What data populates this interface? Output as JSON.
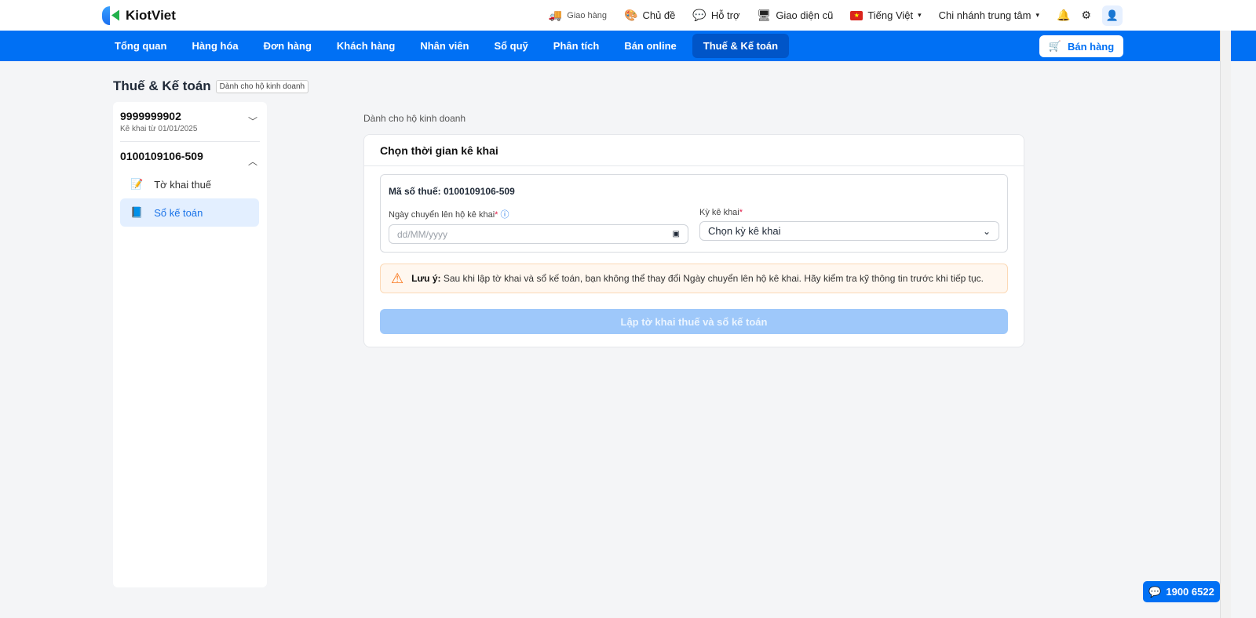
{
  "app": {
    "name": "KiotViet"
  },
  "topbar": {
    "delivery": "Giao hàng",
    "theme": "Chủ đề",
    "support": "Hỗ trợ",
    "old_ui": "Giao diện cũ",
    "language": "Tiếng Việt",
    "branch": "Chi nhánh trung tâm"
  },
  "nav": {
    "items": [
      "Tổng quan",
      "Hàng hóa",
      "Đơn hàng",
      "Khách hàng",
      "Nhân viên",
      "Sổ quỹ",
      "Phân tích",
      "Bán online",
      "Thuế & Kế toán"
    ],
    "active": "Thuế & Kế toán",
    "sell": "Bán hàng"
  },
  "page": {
    "title": "Thuế & Kế toán",
    "tag": "Dành cho hộ kinh doanh"
  },
  "sidebar": {
    "groups": [
      {
        "name": "9999999902",
        "sub": "Kê khai từ 01/01/2025"
      },
      {
        "name": "0100109106-509"
      }
    ],
    "items": [
      "Tờ khai thuế",
      "Sổ kế toán"
    ],
    "active": "Sổ kế toán"
  },
  "main": {
    "caption": "Dành cho hộ kinh doanh",
    "card_title": "Chọn thời gian kê khai",
    "tax_code": "Mã số thuế: 0100109106-509",
    "date_label": "Ngày chuyển lên hộ kê khai",
    "date_placeholder": "dd/MM/yyyy",
    "period_label": "Kỳ kê khai",
    "period_value": "Chọn kỳ kê khai",
    "required": "*",
    "warn_bold": "Lưu ý:",
    "warn_text": "Sau khi lập tờ khai và sổ kế toán, bạn không thể thay đổi Ngày chuyển lên hộ kê khai. Hãy kiểm tra kỹ thông tin trước khi tiếp tục.",
    "submit": "Lập tờ khai thuế và sổ kế toán"
  },
  "hotline": "1900 6522",
  "colors": {
    "brand": "#0070f4",
    "nav_active": "#0055c8",
    "disabled_btn": "#9ec8fa",
    "warn_bg": "#fff7ef"
  }
}
